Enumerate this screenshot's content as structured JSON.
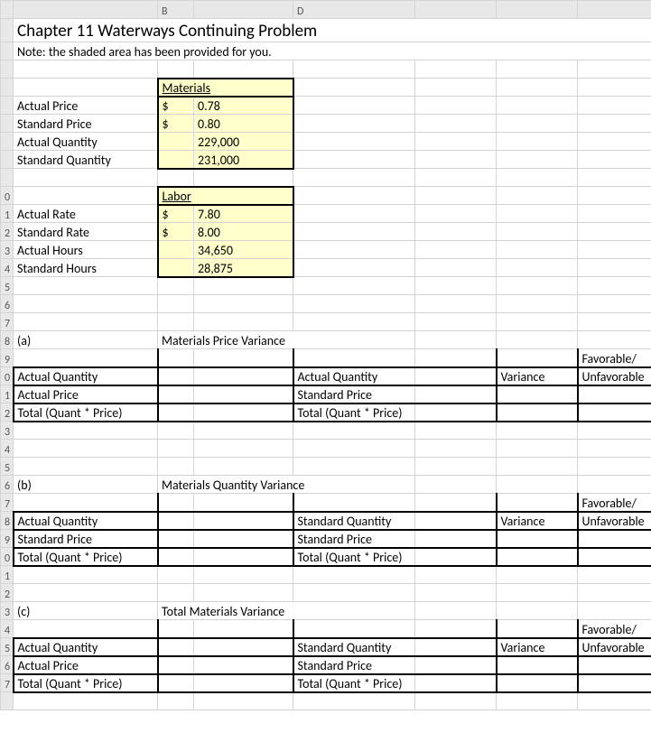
{
  "title": "Chapter 11 Waterways Continuing Problem",
  "note": "Note: the shaded area has been provided for you.",
  "materials": {
    "header": "Materials",
    "rows": [
      {
        "label": "Actual Price",
        "cur": "$",
        "val": "0.78"
      },
      {
        "label": "Standard Price",
        "cur": "$",
        "val": "0.80"
      },
      {
        "label": "Actual Quantity",
        "cur": "",
        "val": "229,000"
      },
      {
        "label": "Standard Quantity",
        "cur": "",
        "val": "231,000"
      }
    ]
  },
  "labor": {
    "header": "Labor",
    "rows": [
      {
        "label": "Actual Rate",
        "cur": "$",
        "val": "7.80"
      },
      {
        "label": "Standard Rate",
        "cur": "$",
        "val": "8.00"
      },
      {
        "label": "Actual Hours",
        "cur": "",
        "val": "34,650"
      },
      {
        "label": "Standard Hours",
        "cur": "",
        "val": "28,875"
      }
    ]
  },
  "sections": {
    "a": {
      "key": "(a)",
      "title": "Materials Price Variance",
      "left": [
        "Actual Quantity",
        "Actual Price",
        "Total (Quant * Price)"
      ],
      "right": [
        "Actual Quantity",
        "Standard Price",
        "Total (Quant * Price)"
      ],
      "var": "Variance",
      "fav": "Favorable/",
      "unfav": "Unfavorable"
    },
    "b": {
      "key": "(b)",
      "title": "Materials Quantity Variance",
      "left": [
        "Actual Quantity",
        "Standard Price",
        "Total (Quant * Price)"
      ],
      "right": [
        "Standard Quantity",
        "Standard Price",
        "Total (Quant * Price)"
      ],
      "var": "Variance",
      "fav": "Favorable/",
      "unfav": "Unfavorable"
    },
    "c": {
      "key": "(c)",
      "title": "Total Materials  Variance",
      "left": [
        "Actual Quantity",
        "Actual Price",
        "Total (Quant * Price)"
      ],
      "right": [
        "Standard Quantity",
        "Standard Price",
        "Total (Quant * Price)"
      ],
      "var": "Variance",
      "fav": "Favorable/",
      "unfav": "Unfavorable"
    }
  },
  "row_numbers": [
    "",
    "",
    "",
    "",
    "",
    "",
    "",
    "",
    "",
    "0",
    "1",
    "2",
    "3",
    "4",
    "5",
    "6",
    "7",
    "8",
    "9",
    "0",
    "1",
    "2",
    "3",
    "4",
    "5",
    "6",
    "7",
    "8",
    "9",
    "0",
    "1",
    "2",
    "3",
    "4",
    "5",
    "6",
    "7",
    ""
  ],
  "col_letters": [
    "",
    "",
    "",
    "",
    "",
    ""
  ],
  "chart_data": {
    "type": "table",
    "title": "Chapter 11 Waterways Continuing Problem",
    "materials": {
      "Actual Price": 0.78,
      "Standard Price": 0.8,
      "Actual Quantity": 229000,
      "Standard Quantity": 231000
    },
    "labor": {
      "Actual Rate": 7.8,
      "Standard Rate": 8.0,
      "Actual Hours": 34650,
      "Standard Hours": 28875
    }
  }
}
